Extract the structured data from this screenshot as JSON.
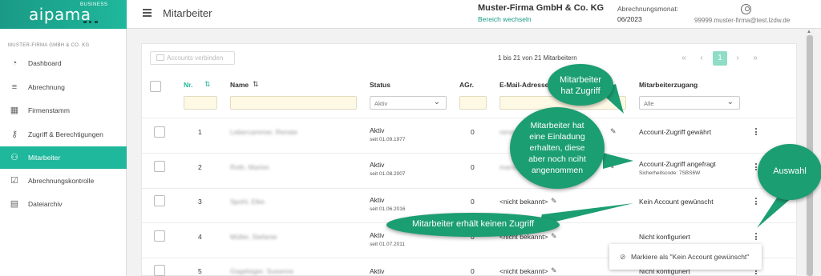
{
  "app": {
    "logo_text": "aipama",
    "logo_sub": "BUSINESS",
    "page_title": "Mitarbeiter",
    "company": "Muster-Firma GmbH & Co. KG",
    "switch_area": "Bereich wechseln",
    "period_label": "Abrechnungsmonat:",
    "period_value": "06/2023",
    "user_email": "99999.muster-firma@test.lzdw.de"
  },
  "sidebar": {
    "firm_label": "MUSTER-FIRMA GMBH & CO. KG",
    "items": [
      {
        "label": "Dashboard",
        "icon": "dashboard-icon",
        "glyph": "◔"
      },
      {
        "label": "Abrechnung",
        "icon": "list-icon",
        "glyph": "≡"
      },
      {
        "label": "Firmenstamm",
        "icon": "building-icon",
        "glyph": "▦"
      },
      {
        "label": "Zugriff & Berechtigungen",
        "icon": "key-icon",
        "glyph": "⚷"
      },
      {
        "label": "Mitarbeiter",
        "icon": "people-icon",
        "glyph": "⚇"
      },
      {
        "label": "Abrechnungskontrolle",
        "icon": "clipboard-check-icon",
        "glyph": "☑"
      },
      {
        "label": "Dateiarchiv",
        "icon": "archive-icon",
        "glyph": "▤"
      }
    ]
  },
  "toolbar": {
    "connect_label": "Accounts verbinden",
    "pager_info": "1 bis 21 von 21 Mitarbeitern",
    "pager": [
      "«",
      "‹",
      "1",
      "›",
      "»"
    ]
  },
  "table": {
    "headers": {
      "nr": "Nr.",
      "name": "Name",
      "status": "Status",
      "agr": "AGr.",
      "email": "E-Mail-Adresse",
      "access": "Mitarbeiterzugang"
    },
    "filters": {
      "status": "Aktiv",
      "access": "Alle"
    },
    "rows": [
      {
        "nr": "1",
        "name": "Lebercammer, Renate",
        "status": "Aktiv",
        "since": "seit 01.09.1977",
        "agr": "0",
        "email": "renate.lebercammer@pa...",
        "access": "Account-Zugriff gewährt",
        "access_sub": ""
      },
      {
        "nr": "2",
        "name": "Roth, Marion",
        "status": "Aktiv",
        "since": "seit 01.08.2007",
        "agr": "0",
        "email": "marion.roth@beispiel.com",
        "access": "Account-Zugriff angefragt",
        "access_sub": "Sicherheitscode: 7SBS6W"
      },
      {
        "nr": "3",
        "name": "Spohl, Elke",
        "status": "Aktiv",
        "since": "seit 01.06.2016",
        "agr": "0",
        "email": "<nicht bekannt>",
        "access": "Kein Account gewünscht",
        "access_sub": ""
      },
      {
        "nr": "4",
        "name": "Müller, Stefanie",
        "status": "Aktiv",
        "since": "seit 01.07.2011",
        "agr": "0",
        "email": "<nicht bekannt>",
        "access": "Nicht konfiguriert",
        "access_sub": ""
      },
      {
        "nr": "5",
        "name": "Gagelsiger, Susanne",
        "status": "Aktiv",
        "since": "",
        "agr": "0",
        "email": "<nicht bekannt>",
        "access": "Nicht konfiguriert",
        "access_sub": ""
      }
    ]
  },
  "popup": {
    "label": "Markiere als \"Kein Account gewünscht\""
  },
  "annotations": {
    "has_access": [
      "Mitarbeiter",
      "hat Zugriff"
    ],
    "invited": [
      "Mitarbeiter hat",
      "eine Einladung",
      "erhalten, diese",
      "aber noch nciht",
      "angenommen"
    ],
    "no_access": "Mitarbeiter erhält keinen Zugriff",
    "selection": "Auswahl"
  },
  "colors": {
    "accent": "#1fb89c",
    "annotation": "#1b9e71",
    "filter_bg": "#fdf9e4"
  }
}
